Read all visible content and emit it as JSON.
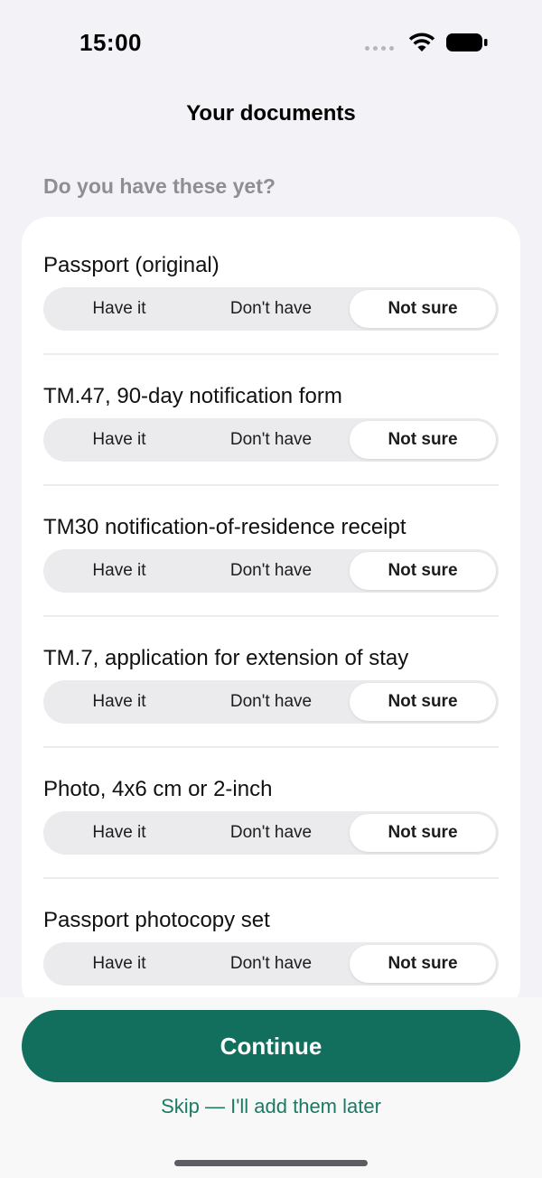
{
  "status_bar": {
    "time": "15:00",
    "icons": [
      "signal-dots-icon",
      "wifi-icon",
      "battery-icon"
    ]
  },
  "nav": {
    "title": "Your documents"
  },
  "section_label": "Do you have these yet?",
  "segment_options": [
    "Have it",
    "Don't have",
    "Not sure"
  ],
  "documents": [
    {
      "title": "Passport (original)",
      "selected": "Not sure"
    },
    {
      "title": "TM.47, 90-day notification form",
      "selected": "Not sure"
    },
    {
      "title": "TM30 notification-of-residence receipt",
      "selected": "Not sure"
    },
    {
      "title": "TM.7, application for extension of stay",
      "selected": "Not sure"
    },
    {
      "title": "Photo, 4x6 cm or 2-inch",
      "selected": "Not sure"
    },
    {
      "title": "Passport photocopy set",
      "selected": "Not sure"
    }
  ],
  "footer": {
    "continue_label": "Continue",
    "skip_label": "Skip — I'll add them later"
  },
  "colors": {
    "accent": "#126f5e",
    "link": "#1a7a63",
    "background": "#f2f2f7",
    "secondary_text": "#8e8e93"
  }
}
